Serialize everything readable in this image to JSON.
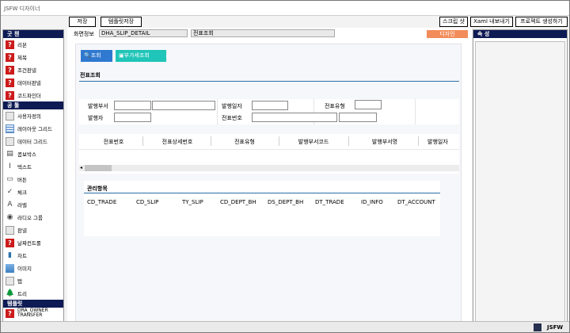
{
  "window": {
    "title": "JSFW 디자이너"
  },
  "toolbar": {
    "save": "저장",
    "template_save": "템플릿저장",
    "script": "스크립 샷",
    "xaml_export": "Xaml 내보내기",
    "project_generate": "프로젝트 생성하기"
  },
  "left_panel": {
    "control_header": "굿 챈",
    "control_items": [
      "리본",
      "제목",
      "조건판넬",
      "데이터판넬",
      "코드파인더"
    ],
    "tools_header": "공 툴",
    "tool_items": [
      "사용자정의",
      "레이아웃 그리드",
      "데이터 그리드",
      "콤보박스",
      "텍스트",
      "버튼",
      "체크",
      "라벨",
      "라디오 그룹",
      "판넬",
      "날짜컨트롤",
      "차트",
      "이미지",
      "탭",
      "트리"
    ],
    "template_header": "템플릿",
    "template_items": [
      "DRA_OWNER TRANSFER"
    ]
  },
  "infobar": {
    "label": "화면정보",
    "screen_id": "DHA_SLIP_DETAIL",
    "screen_name": "전표조회",
    "design_button": "디자인"
  },
  "canvas": {
    "tab_query": "조회",
    "tab_extra": "부가세조회",
    "section_title": "전표조회",
    "form": {
      "dept_label": "발행부서",
      "date_label": "발행일자",
      "type_label": "전표유형",
      "issuer_label": "발행자",
      "slip_no_label": "전표번호"
    },
    "grid_columns": [
      "전표번호",
      "전표상세번호",
      "전표유형",
      "발행부서코드",
      "발행부서명",
      "발행일자"
    ],
    "manage_title": "관리항목",
    "manage_columns": [
      "CD_TRADE",
      "CD_SLIP",
      "TY_SLIP",
      "CD_DEPT_BH",
      "DS_DEPT_BH",
      "DT_TRADE",
      "ID_INFO",
      "DT_ACCOUNT"
    ]
  },
  "right_panel": {
    "header": "속 성"
  },
  "statusbar": {
    "label": "JSFW"
  }
}
